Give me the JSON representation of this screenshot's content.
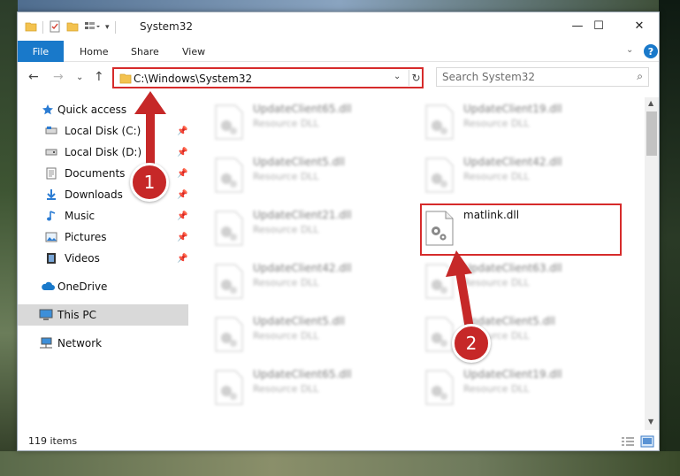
{
  "window": {
    "title": "System32",
    "controls": {
      "minimize": "—",
      "maximize": "☐",
      "close": "✕"
    }
  },
  "ribbon": {
    "tabs": [
      "File",
      "Home",
      "Share",
      "View"
    ],
    "chevron": "⌄",
    "help": "?"
  },
  "navigation": {
    "back": "←",
    "forward": "→",
    "recent": "⌄",
    "up": "↑",
    "address": "C:\\Windows\\System32",
    "dropdown": "⌄",
    "refresh": "↻",
    "search_placeholder": "Search System32"
  },
  "sidebar": {
    "items": [
      {
        "label": "Quick access",
        "icon": "star-icon"
      },
      {
        "label": "Local Disk (C:)",
        "icon": "drive-icon",
        "pinned": true
      },
      {
        "label": "Local Disk (D:)",
        "icon": "drive-icon",
        "pinned": true
      },
      {
        "label": "Documents",
        "icon": "documents-icon",
        "pinned": true
      },
      {
        "label": "Downloads",
        "icon": "downloads-icon",
        "pinned": true
      },
      {
        "label": "Music",
        "icon": "music-icon",
        "pinned": true
      },
      {
        "label": "Pictures",
        "icon": "pictures-icon",
        "pinned": true
      },
      {
        "label": "Videos",
        "icon": "videos-icon",
        "pinned": true
      },
      {
        "label": "OneDrive",
        "icon": "cloud-icon"
      },
      {
        "label": "This PC",
        "icon": "computer-icon",
        "selected": true
      },
      {
        "label": "Network",
        "icon": "network-icon"
      }
    ]
  },
  "files": {
    "left_column": [
      {
        "name": "UpdateClient65.dll",
        "type": "Resource DLL"
      },
      {
        "name": "UpdateClient5.dll",
        "type": "Resource DLL"
      },
      {
        "name": "UpdateClient21.dll",
        "type": "Resource DLL"
      },
      {
        "name": "UpdateClient42.dll",
        "type": "Resource DLL"
      },
      {
        "name": "UpdateClient5.dll",
        "type": "Resource DLL"
      },
      {
        "name": "UpdateClient65.dll",
        "type": "Resource DLL"
      }
    ],
    "right_column": [
      {
        "name": "UpdateClient19.dll",
        "type": "Resource DLL"
      },
      {
        "name": "UpdateClient42.dll",
        "type": "Resource DLL"
      },
      {
        "name": "matlink.dll",
        "type": ""
      },
      {
        "name": "UpdateClient63.dll",
        "type": "Resource DLL"
      },
      {
        "name": "UpdateClient5.dll",
        "type": "Resource DLL"
      },
      {
        "name": "UpdateClient19.dll",
        "type": "Resource DLL"
      }
    ]
  },
  "status": {
    "item_count": "119 items"
  },
  "annotations": {
    "step1": "1",
    "step2": "2"
  },
  "colors": {
    "accent": "#1979ca",
    "annotation_red": "#c62828",
    "highlight_border": "#d62b2b"
  }
}
